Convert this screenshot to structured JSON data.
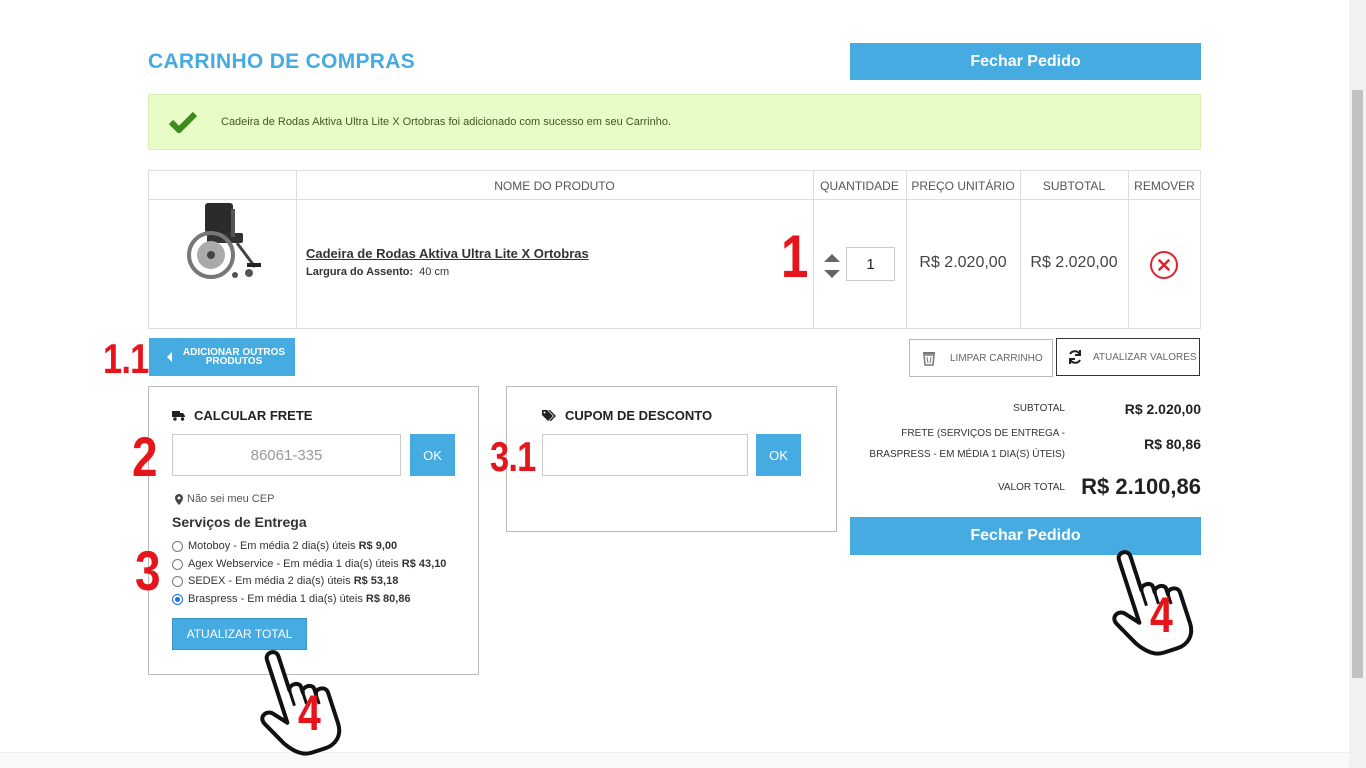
{
  "header": {
    "title": "CARRINHO DE COMPRAS",
    "fechar_pedido": "Fechar Pedido"
  },
  "alert": {
    "message": "Cadeira de Rodas Aktiva Ultra Lite X Ortobras foi adicionado com sucesso em seu Carrinho."
  },
  "table": {
    "headers": [
      "",
      "NOME DO PRODUTO",
      "QUANTIDADE",
      "PREÇO UNITÁRIO",
      "SUBTOTAL",
      "REMOVER"
    ],
    "item": {
      "name": "Cadeira de Rodas Aktiva Ultra Lite X Ortobras",
      "attr_label": "Largura do Assento:",
      "attr_value": "40 cm",
      "quantity": "1",
      "unit_price": "R$ 2.020,00",
      "subtotal": "R$ 2.020,00"
    }
  },
  "actions": {
    "adicionar": "ADICIONAR OUTROS PRODUTOS",
    "limpar": "LIMPAR CARRINHO",
    "atualizar": "ATUALIZAR VALORES"
  },
  "frete": {
    "title": "CALCULAR FRETE",
    "cep_value": "86061-335",
    "ok": "OK",
    "nao_sei_cep": "Não sei meu CEP",
    "servicos_title": "Serviços de Entrega",
    "services": [
      {
        "label": "Motoboy - Em média 2 dia(s) úteis",
        "price": "R$ 9,00",
        "checked": false
      },
      {
        "label": "Agex Webservice - Em média 1 dia(s) úteis",
        "price": "R$ 43,10",
        "checked": false
      },
      {
        "label": "SEDEX - Em média 2 dia(s) úteis",
        "price": "R$ 53,18",
        "checked": false
      },
      {
        "label": "Braspress - Em média 1 dia(s) úteis",
        "price": "R$ 80,86",
        "checked": true
      }
    ],
    "atualizar_total": "ATUALIZAR TOTAL"
  },
  "cupom": {
    "title": "CUPOM DE DESCONTO",
    "value": "",
    "ok": "OK"
  },
  "summary": {
    "subtotal_label": "SUBTOTAL",
    "subtotal_value": "R$ 2.020,00",
    "frete_label_1": "FRETE (SERVIÇOS DE ENTREGA -",
    "frete_label_2": "BRASPRESS - EM MÉDIA 1 DIA(S) ÚTEIS)",
    "frete_value": "R$ 80,86",
    "total_label": "VALOR TOTAL",
    "total_value": "R$ 2.100,86"
  },
  "annotations": {
    "a1": "1",
    "a11": "1.1",
    "a2": "2",
    "a3": "3",
    "a31": "3.1",
    "a4": "4"
  },
  "colors": {
    "accent": "#45abe0",
    "alert_bg": "#e7fcc6",
    "annotation": "#e5151b",
    "remove": "#e0232d"
  }
}
